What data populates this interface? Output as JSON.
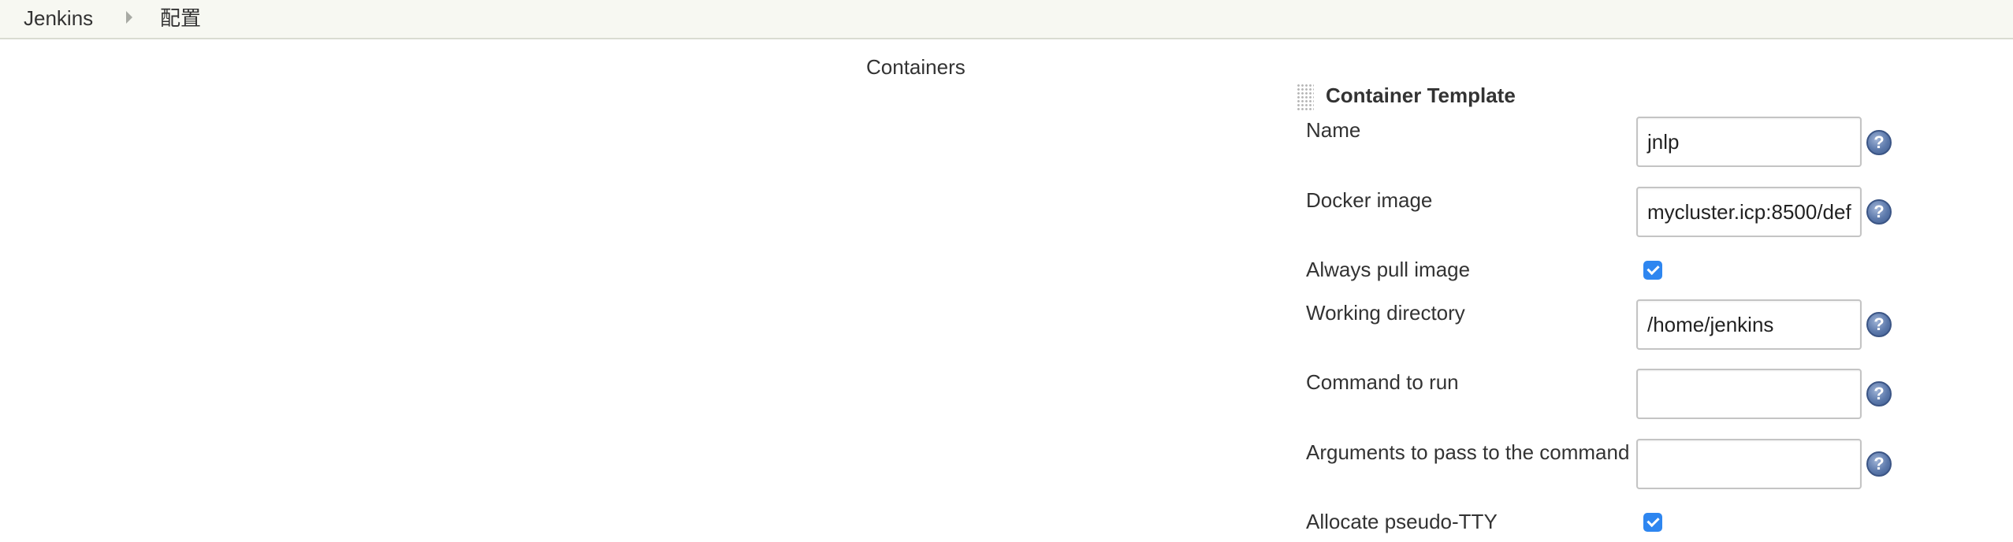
{
  "breadcrumb": {
    "root": "Jenkins",
    "current": "配置"
  },
  "section": {
    "label": "Containers"
  },
  "template": {
    "title": "Container Template",
    "fields": {
      "name": {
        "label": "Name",
        "value": "jnlp"
      },
      "docker_image": {
        "label": "Docker image",
        "value": "mycluster.icp:8500/def"
      },
      "always_pull": {
        "label": "Always pull image",
        "checked": true
      },
      "working_dir": {
        "label": "Working directory",
        "value": "/home/jenkins"
      },
      "command": {
        "label": "Command to run",
        "value": ""
      },
      "arguments": {
        "label": "Arguments to pass to the command",
        "value": ""
      },
      "pseudo_tty": {
        "label": "Allocate pseudo-TTY",
        "checked": true
      }
    }
  },
  "icons": {
    "help": "help-icon",
    "help_glyph": "?",
    "separator": "chevron-right-icon",
    "drag": "drag-handle-icon"
  },
  "colors": {
    "breadcrumb_bg": "#f7f8f2",
    "checkbox": "#2e86f0",
    "help_icon": "#5c79ab"
  }
}
